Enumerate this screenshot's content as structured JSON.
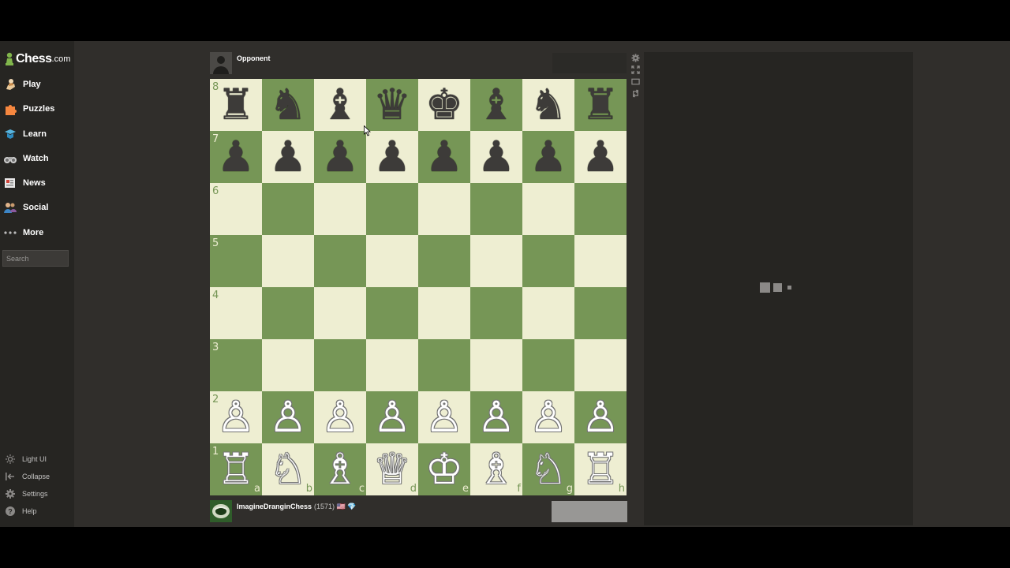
{
  "brand": {
    "logo_word": "Chess",
    "logo_tld": ".com"
  },
  "nav": {
    "items": [
      {
        "key": "play",
        "label": "Play",
        "icon": "pawn-hand-icon"
      },
      {
        "key": "puzzles",
        "label": "Puzzles",
        "icon": "puzzle-icon"
      },
      {
        "key": "learn",
        "label": "Learn",
        "icon": "graduation-cap-icon"
      },
      {
        "key": "watch",
        "label": "Watch",
        "icon": "binoculars-icon"
      },
      {
        "key": "news",
        "label": "News",
        "icon": "newspaper-icon"
      },
      {
        "key": "social",
        "label": "Social",
        "icon": "people-icon"
      },
      {
        "key": "more",
        "label": "More",
        "icon": "ellipsis-icon"
      }
    ],
    "search_placeholder": "Search"
  },
  "footer": {
    "light_ui": "Light UI",
    "collapse": "Collapse",
    "settings": "Settings",
    "help": "Help"
  },
  "opponent": {
    "name": "Opponent"
  },
  "player": {
    "name": "ImagineDranginChess",
    "rating": "(1571)",
    "flag": "🇺🇸",
    "badge": "💎"
  },
  "board": {
    "ranks": [
      "8",
      "7",
      "6",
      "5",
      "4",
      "3",
      "2",
      "1"
    ],
    "files": [
      "a",
      "b",
      "c",
      "d",
      "e",
      "f",
      "g",
      "h"
    ],
    "position": [
      [
        "♜",
        "♞",
        "♝",
        "♛",
        "♚",
        "♝",
        "♞",
        "♜"
      ],
      [
        "♟",
        "♟",
        "♟",
        "♟",
        "♟",
        "♟",
        "♟",
        "♟"
      ],
      [
        "",
        "",
        "",
        "",
        "",
        "",
        "",
        ""
      ],
      [
        "",
        "",
        "",
        "",
        "",
        "",
        "",
        ""
      ],
      [
        "",
        "",
        "",
        "",
        "",
        "",
        "",
        ""
      ],
      [
        "",
        "",
        "",
        "",
        "",
        "",
        "",
        ""
      ],
      [
        "♙",
        "♙",
        "♙",
        "♙",
        "♙",
        "♙",
        "♙",
        "♙"
      ],
      [
        "♖",
        "♘",
        "♗",
        "♕",
        "♔",
        "♗",
        "♘",
        "♖"
      ]
    ],
    "colors": {
      "light": "#eeeed2",
      "dark": "#769656"
    }
  },
  "board_controls": [
    "gear-icon",
    "expand-icon",
    "theater-icon",
    "flip-board-icon"
  ]
}
